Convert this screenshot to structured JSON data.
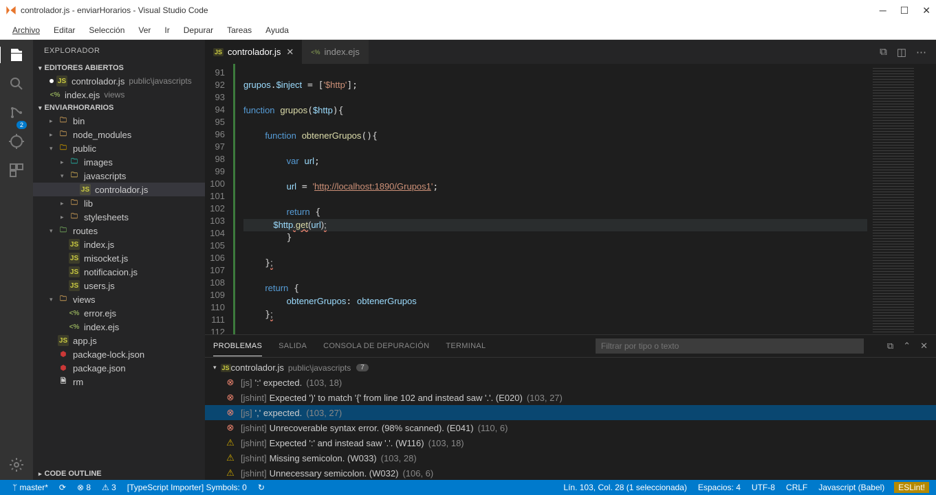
{
  "title": "controlador.js - enviarHorarios - Visual Studio Code",
  "menu": [
    "Archivo",
    "Editar",
    "Selección",
    "Ver",
    "Ir",
    "Depurar",
    "Tareas",
    "Ayuda"
  ],
  "activity_badge": "2",
  "sidebar": {
    "title": "EXPLORADOR",
    "open_editors": {
      "title": "EDITORES ABIERTOS",
      "items": [
        {
          "icon": "JS",
          "name": "controlador.js",
          "dim": "public\\javascripts",
          "modified": true
        },
        {
          "icon": "<%",
          "name": "index.ejs",
          "dim": "views"
        }
      ]
    },
    "workspace": {
      "title": "ENVIARHORARIOS",
      "tree": [
        {
          "depth": 1,
          "chev": "▸",
          "icon": "folder-bin",
          "name": "bin"
        },
        {
          "depth": 1,
          "chev": "▸",
          "icon": "folder",
          "name": "node_modules"
        },
        {
          "depth": 1,
          "chev": "▾",
          "icon": "folder-public",
          "name": "public"
        },
        {
          "depth": 2,
          "chev": "▸",
          "icon": "folder-img",
          "name": "images"
        },
        {
          "depth": 2,
          "chev": "▾",
          "icon": "folder-js",
          "name": "javascripts"
        },
        {
          "depth": 3,
          "icon": "JS",
          "name": "controlador.js",
          "active": true
        },
        {
          "depth": 2,
          "chev": "▸",
          "icon": "folder",
          "name": "lib"
        },
        {
          "depth": 2,
          "chev": "▸",
          "icon": "folder",
          "name": "stylesheets"
        },
        {
          "depth": 1,
          "chev": "▾",
          "icon": "folder-routes",
          "name": "routes"
        },
        {
          "depth": 2,
          "icon": "JS",
          "name": "index.js"
        },
        {
          "depth": 2,
          "icon": "JS",
          "name": "misocket.js"
        },
        {
          "depth": 2,
          "icon": "JS",
          "name": "notificacion.js"
        },
        {
          "depth": 2,
          "icon": "JS",
          "name": "users.js"
        },
        {
          "depth": 1,
          "chev": "▾",
          "icon": "folder-views",
          "name": "views"
        },
        {
          "depth": 2,
          "icon": "<%",
          "name": "error.ejs"
        },
        {
          "depth": 2,
          "icon": "<%",
          "name": "index.ejs"
        },
        {
          "depth": 1,
          "icon": "JS",
          "name": "app.js"
        },
        {
          "depth": 1,
          "icon": "npm",
          "name": "package-lock.json"
        },
        {
          "depth": 1,
          "icon": "npm",
          "name": "package.json"
        },
        {
          "depth": 1,
          "icon": "file",
          "name": "rm"
        }
      ]
    },
    "outline_title": "CODE OUTLINE"
  },
  "tabs": [
    {
      "icon": "JS",
      "name": "controlador.js",
      "active": true,
      "close": true
    },
    {
      "icon": "<%",
      "name": "index.ejs"
    }
  ],
  "lines": [
    91,
    92,
    93,
    94,
    95,
    96,
    97,
    98,
    99,
    100,
    101,
    102,
    103,
    104,
    105,
    106,
    107,
    108,
    109,
    110,
    111,
    112
  ],
  "code": {
    "l92a": "grupos",
    "l92b": ".",
    "l92c": "$inject",
    "l92d": " = [",
    "l92e": "'$http'",
    "l92f": "];",
    "l94a": "function",
    "l94b": " ",
    "l94c": "grupos",
    "l94d": "(",
    "l94e": "$http",
    "l94f": "){",
    "l96a": "function",
    "l96b": " ",
    "l96c": "obtenerGrupos",
    "l96d": "(){",
    "l98a": "var",
    "l98b": " ",
    "l98c": "url",
    "l98d": ";",
    "l100a": "url",
    "l100b": " = ",
    "l100c": "'",
    "l100d": "http://localhost:1890/Grupos1",
    "l100e": "'",
    "l100f": ";",
    "l102a": "return",
    "l102b": " {",
    "l103a": "$http",
    "l103b": ".",
    "l103c": "get",
    "l103d": "(",
    "l103e": "url",
    "l103f": ")",
    "l103g": ";",
    "l104": "}",
    "l106": "}",
    "l106b": ";",
    "l108a": "return",
    "l108b": " {",
    "l109a": "obtenerGrupos",
    "l109b": ": ",
    "l109c": "obtenerGrupos",
    "l110": "}",
    "l110b": ";",
    "l112": "}"
  },
  "panel": {
    "tabs": [
      "PROBLEMAS",
      "SALIDA",
      "CONSOLA DE DEPURACIÓN",
      "TERMINAL"
    ],
    "filter_placeholder": "Filtrar por tipo o texto",
    "file": {
      "icon": "JS",
      "name": "controlador.js",
      "dim": "public\\javascripts",
      "count": "7"
    },
    "problems": [
      {
        "sev": "error",
        "src": "[js]",
        "msg": "':' expected.",
        "loc": "(103, 18)"
      },
      {
        "sev": "error",
        "src": "[jshint]",
        "msg": "Expected ')' to match '{' from line 102 and instead saw '.'. (E020)",
        "loc": "(103, 27)"
      },
      {
        "sev": "error",
        "src": "[js]",
        "msg": "',' expected.",
        "loc": "(103, 27)",
        "active": true
      },
      {
        "sev": "error",
        "src": "[jshint]",
        "msg": "Unrecoverable syntax error. (98% scanned). (E041)",
        "loc": "(110, 6)"
      },
      {
        "sev": "warn",
        "src": "[jshint]",
        "msg": "Expected ':' and instead saw '.'. (W116)",
        "loc": "(103, 18)"
      },
      {
        "sev": "warn",
        "src": "[jshint]",
        "msg": "Missing semicolon. (W033)",
        "loc": "(103, 28)"
      },
      {
        "sev": "warn",
        "src": "[jshint]",
        "msg": "Unnecessary semicolon. (W032)",
        "loc": "(106, 6)"
      }
    ]
  },
  "status": {
    "branch": "master*",
    "sync": "⟳",
    "errors": "⊗ 8",
    "warns": "⚠ 3",
    "ts": "[TypeScript Importer] Symbols: 0",
    "refresh": "↻",
    "pos": "Lín. 103, Col. 28 (1 seleccionada)",
    "spaces": "Espacios: 4",
    "enc": "UTF-8",
    "eol": "CRLF",
    "lang": "Javascript (Babel)",
    "eslint": "ESLint!"
  }
}
